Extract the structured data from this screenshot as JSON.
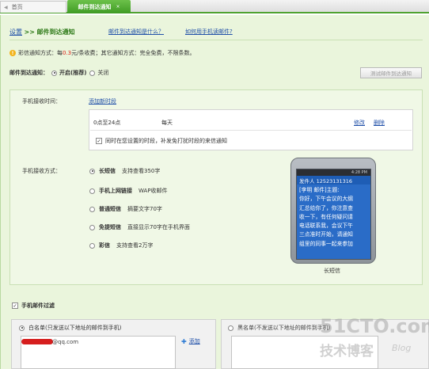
{
  "tabs": {
    "home": "首页",
    "active": "邮件到达通知",
    "close": "×"
  },
  "header": {
    "crumb_settings": "设置",
    "crumb_sep": ">>",
    "crumb_current": "邮件到达通知",
    "help_what": "邮件到达通知是什么？",
    "help_how": "如何用手机读邮件?"
  },
  "fee": {
    "prefix": "彩信通知方式：每",
    "price": "0.3",
    "suffix": "元/条收费；其它通知方式：完全免费，不限条数。"
  },
  "notify": {
    "label": "邮件到达通知：",
    "on": "开启(推荐)",
    "off": "关闭",
    "test_button": "测试邮件到达通知"
  },
  "receive_time": {
    "label": "手机接收时间：",
    "add_slot": "添加新时段",
    "slot_range": "0点至24点",
    "slot_days": "每天",
    "edit": "修改",
    "delete": "删除",
    "checkbox_label": "同时在您设置的时段，补发免打扰时段的来信通知"
  },
  "receive_method": {
    "label": "手机接收方式：",
    "options": [
      {
        "name": "长短信",
        "desc": "支持查看350字"
      },
      {
        "name": "手机上网链接",
        "desc": "WAP收邮件"
      },
      {
        "name": "普通短信",
        "desc": "摘要文字70字"
      },
      {
        "name": "免提短信",
        "desc": "直接显示70字在手机界面"
      },
      {
        "name": "彩信",
        "desc": "支持查看2万字"
      }
    ],
    "selected_index": 0
  },
  "phone": {
    "status_time": "4:28 PM",
    "sender": "发件人 12523131316",
    "lines": [
      "[李明 邮件]主题:",
      "你好，下午会议的大纲",
      "汇总给你了，你注意查",
      "收一下，有任何疑问请",
      "电话联系我，会议下午",
      "三点准时开始，请通知",
      "组里的同事一起来参加"
    ],
    "caption": "长短信"
  },
  "filter": {
    "label": "手机邮件过滤",
    "whitelist_label": "白名单(只发送以下地址的邮件到手机)",
    "whitelist_email": "@qq.com",
    "add": "添加",
    "blacklist_label": "黑名单(不发送以下地址的邮件到手机)"
  },
  "watermark": {
    "site": "51CTO.com",
    "cn": "技术博客",
    "blog": "Blog"
  },
  "colors": {
    "accent_green": "#4fa230",
    "link_blue": "#1f4fa8",
    "price_red": "#e0251b",
    "panel_bg": "#eaf5dc"
  }
}
